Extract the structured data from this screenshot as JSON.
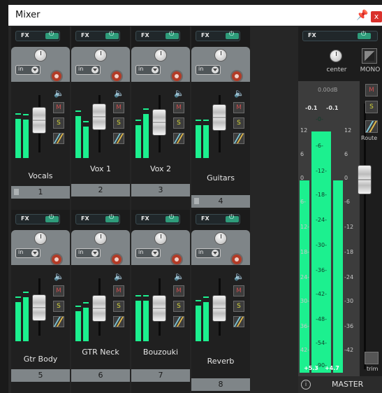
{
  "window": {
    "title": "Mixer"
  },
  "channels": [
    {
      "name": "Vocals",
      "number": "1",
      "fx": "FX",
      "input": "in",
      "mute": "M",
      "solo": "S"
    },
    {
      "name": "Vox 1",
      "number": "2",
      "fx": "FX",
      "input": "in",
      "mute": "M",
      "solo": "S"
    },
    {
      "name": "Vox 2",
      "number": "3",
      "fx": "FX",
      "input": "in",
      "mute": "M",
      "solo": "S"
    },
    {
      "name": "Guitars",
      "number": "4",
      "fx": "FX",
      "input": "in",
      "mute": "M",
      "solo": "S"
    },
    {
      "name": "Gtr Body",
      "number": "5",
      "fx": "FX",
      "input": "in",
      "mute": "M",
      "solo": "S"
    },
    {
      "name": "GTR Neck",
      "number": "6",
      "fx": "FX",
      "input": "in",
      "mute": "M",
      "solo": "S"
    },
    {
      "name": "Bouzouki",
      "number": "7",
      "fx": "FX",
      "input": "in",
      "mute": "M",
      "solo": "S"
    },
    {
      "name": "Reverb",
      "number": "8",
      "fx": "FX",
      "input": "in",
      "mute": "M",
      "solo": "S"
    }
  ],
  "master": {
    "fx": "FX",
    "pan": "center",
    "mono": "MONO",
    "volume": "0.00dB",
    "peak_left": "-0.1",
    "peak_right": "-0.1",
    "rms_left": "+5.3",
    "rms_right": "+4.7",
    "mute": "M",
    "solo": "S",
    "route": "Route",
    "trim": "trim",
    "label": "MASTER",
    "info": "i",
    "scale_left": [
      "12",
      "6",
      "0",
      "6-",
      "12-",
      "18-",
      "24-",
      "30-",
      "36-",
      "42-"
    ],
    "scale_center": [
      "-0-",
      "-6-",
      "-12-",
      "-18-",
      "-24-",
      "-30-",
      "-36-",
      "-42-",
      "-48-",
      "-54-",
      "-90-"
    ],
    "scale_right": [
      "12",
      "6",
      "0",
      "-6",
      "-12",
      "-18",
      "-24",
      "-30",
      "-36",
      "-42"
    ]
  },
  "colors": {
    "meter": "#1cf08f",
    "fx_on": "#2e9b7a",
    "header": "#7f8588",
    "close": "#d9302b"
  }
}
